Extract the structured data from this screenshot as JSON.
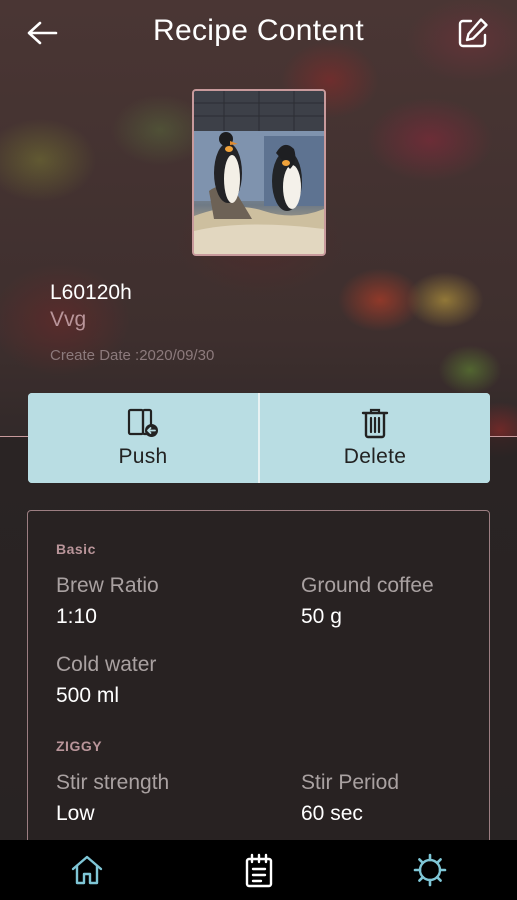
{
  "header": {
    "title": "Recipe Content",
    "back_icon": "arrow-left-icon",
    "edit_icon": "edit-icon"
  },
  "recipe": {
    "name": "L60120h",
    "subtitle": "Vvg",
    "create_date": "Create Date :2020/09/30"
  },
  "actions": {
    "push_label": "Push",
    "push_icon": "push-icon",
    "delete_label": "Delete",
    "delete_icon": "trash-icon"
  },
  "card": {
    "basic_title": "Basic",
    "brew_ratio_label": "Brew Ratio",
    "brew_ratio_value": "1:10",
    "ground_coffee_label": "Ground coffee",
    "ground_coffee_value": "50 g",
    "cold_water_label": "Cold water",
    "cold_water_value": "500 ml",
    "ziggy_title": "ZIGGY",
    "stir_strength_label": "Stir strength",
    "stir_strength_value": "Low",
    "stir_period_label": "Stir Period",
    "stir_period_value": "60 sec"
  },
  "nav": {
    "home_icon": "home-icon",
    "recipes_icon": "recipe-list-icon",
    "settings_icon": "gear-icon"
  },
  "colors": {
    "accent": "#b9dde3",
    "icon_accent": "#7fc6d6",
    "muted_pink": "#b9959a",
    "nav_bg": "#000000"
  }
}
